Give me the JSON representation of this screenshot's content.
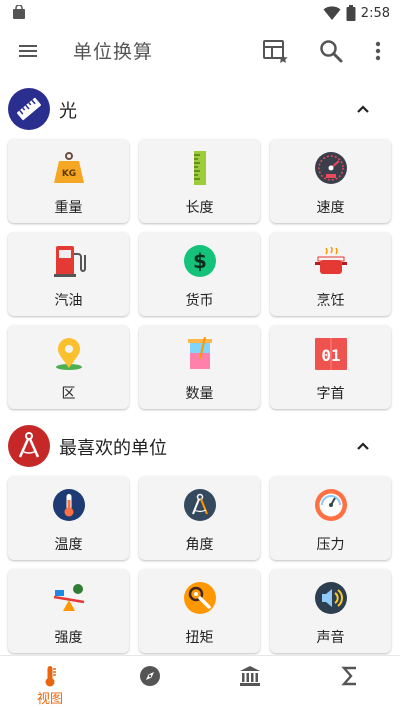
{
  "status_bar": {
    "time": "2:58"
  },
  "app_bar": {
    "title": "单位换算"
  },
  "sections": [
    {
      "title": "光",
      "items": [
        {
          "label": "重量",
          "icon": "weight-icon"
        },
        {
          "label": "长度",
          "icon": "ruler-icon"
        },
        {
          "label": "速度",
          "icon": "speedometer-icon"
        },
        {
          "label": "汽油",
          "icon": "fuel-pump-icon"
        },
        {
          "label": "货币",
          "icon": "dollar-coin-icon"
        },
        {
          "label": "烹饪",
          "icon": "cooking-pot-icon"
        },
        {
          "label": "区",
          "icon": "map-pin-icon"
        },
        {
          "label": "数量",
          "icon": "beaker-icon"
        },
        {
          "label": "字首",
          "icon": "digits-icon"
        }
      ]
    },
    {
      "title": "最喜欢的单位",
      "items": [
        {
          "label": "温度",
          "icon": "thermometer-icon"
        },
        {
          "label": "角度",
          "icon": "compass-angle-icon"
        },
        {
          "label": "压力",
          "icon": "pressure-gauge-icon"
        },
        {
          "label": "强度",
          "icon": "balance-icon"
        },
        {
          "label": "扭矩",
          "icon": "wrench-icon"
        },
        {
          "label": "声音",
          "icon": "speaker-icon"
        }
      ]
    }
  ],
  "bottom_nav": [
    {
      "label": "视图",
      "icon": "thermometer-view-icon",
      "active": true
    },
    {
      "label": "",
      "icon": "compass-icon"
    },
    {
      "label": "",
      "icon": "bank-icon"
    },
    {
      "label": "",
      "icon": "sigma-icon"
    }
  ],
  "colors": {
    "accent": "#e8660f",
    "section1_badge": "#2a2f8f",
    "section2_badge": "#c62828",
    "card_bg": "#f4f4f4"
  }
}
